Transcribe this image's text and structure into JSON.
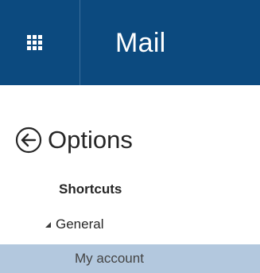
{
  "header": {
    "app_title": "Mail",
    "launcher_icon": "waffle-icon",
    "background_color": "#0c4a7f"
  },
  "options": {
    "back_icon": "back-arrow-circle-icon",
    "title": "Options"
  },
  "nav": {
    "items": [
      {
        "label": "Shortcuts",
        "bold": true
      },
      {
        "label": "General",
        "expanded": true,
        "expand_icon": "triangle-expanded-icon"
      },
      {
        "label": "My account",
        "selected": true
      }
    ],
    "selected_color": "#b3c8de"
  }
}
